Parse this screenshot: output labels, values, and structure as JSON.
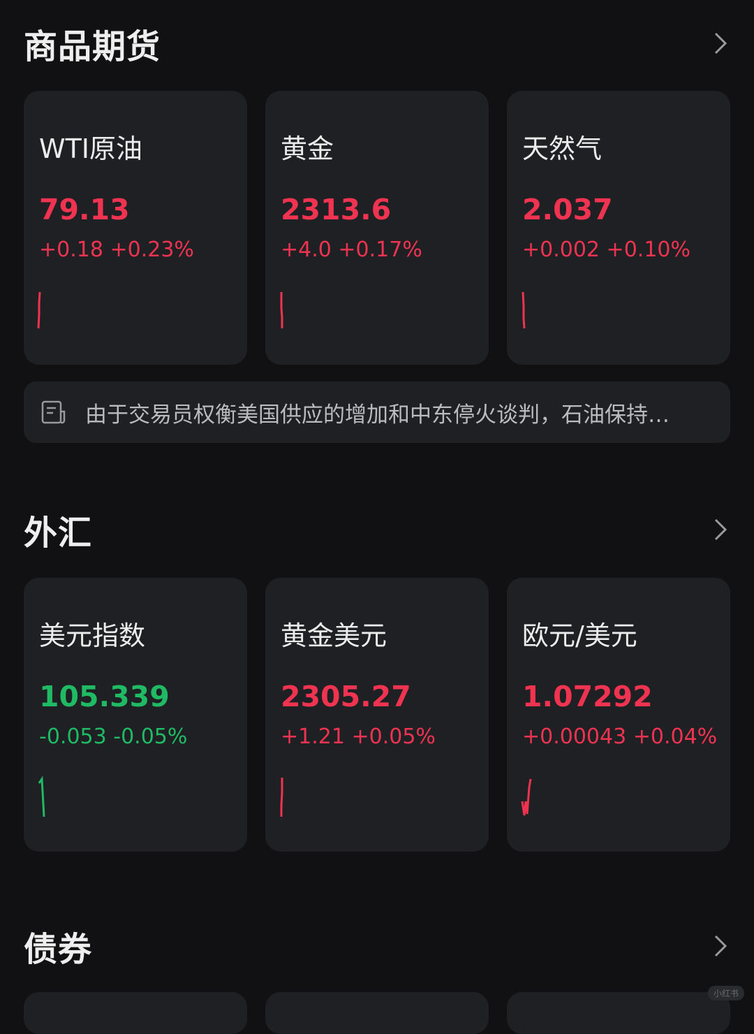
{
  "colors": {
    "up": "#ef3350",
    "down": "#1fba63",
    "card_bg": "#1f2023",
    "page_bg": "#111113"
  },
  "commodities": {
    "title": "商品期货",
    "cards": [
      {
        "name": "WTI原油",
        "price": "79.13",
        "change": "+0.18 +0.23%",
        "trend": "up"
      },
      {
        "name": "黄金",
        "price": "2313.6",
        "change": "+4.0 +0.17%",
        "trend": "up"
      },
      {
        "name": "天然气",
        "price": "2.037",
        "change": "+0.002 +0.10%",
        "trend": "up"
      }
    ],
    "news": "由于交易员权衡美国供应的增加和中东停火谈判，石油保持…"
  },
  "forex": {
    "title": "外汇",
    "cards": [
      {
        "name": "美元指数",
        "price": "105.339",
        "change": "-0.053 -0.05%",
        "trend": "down"
      },
      {
        "name": "黄金美元",
        "price": "2305.27",
        "change": "+1.21 +0.05%",
        "trend": "up"
      },
      {
        "name": "欧元/美元",
        "price": "1.07292",
        "change": "+0.00043 +0.04%",
        "trend": "up"
      }
    ]
  },
  "bonds": {
    "title": "债券"
  },
  "watermark": "小红书"
}
